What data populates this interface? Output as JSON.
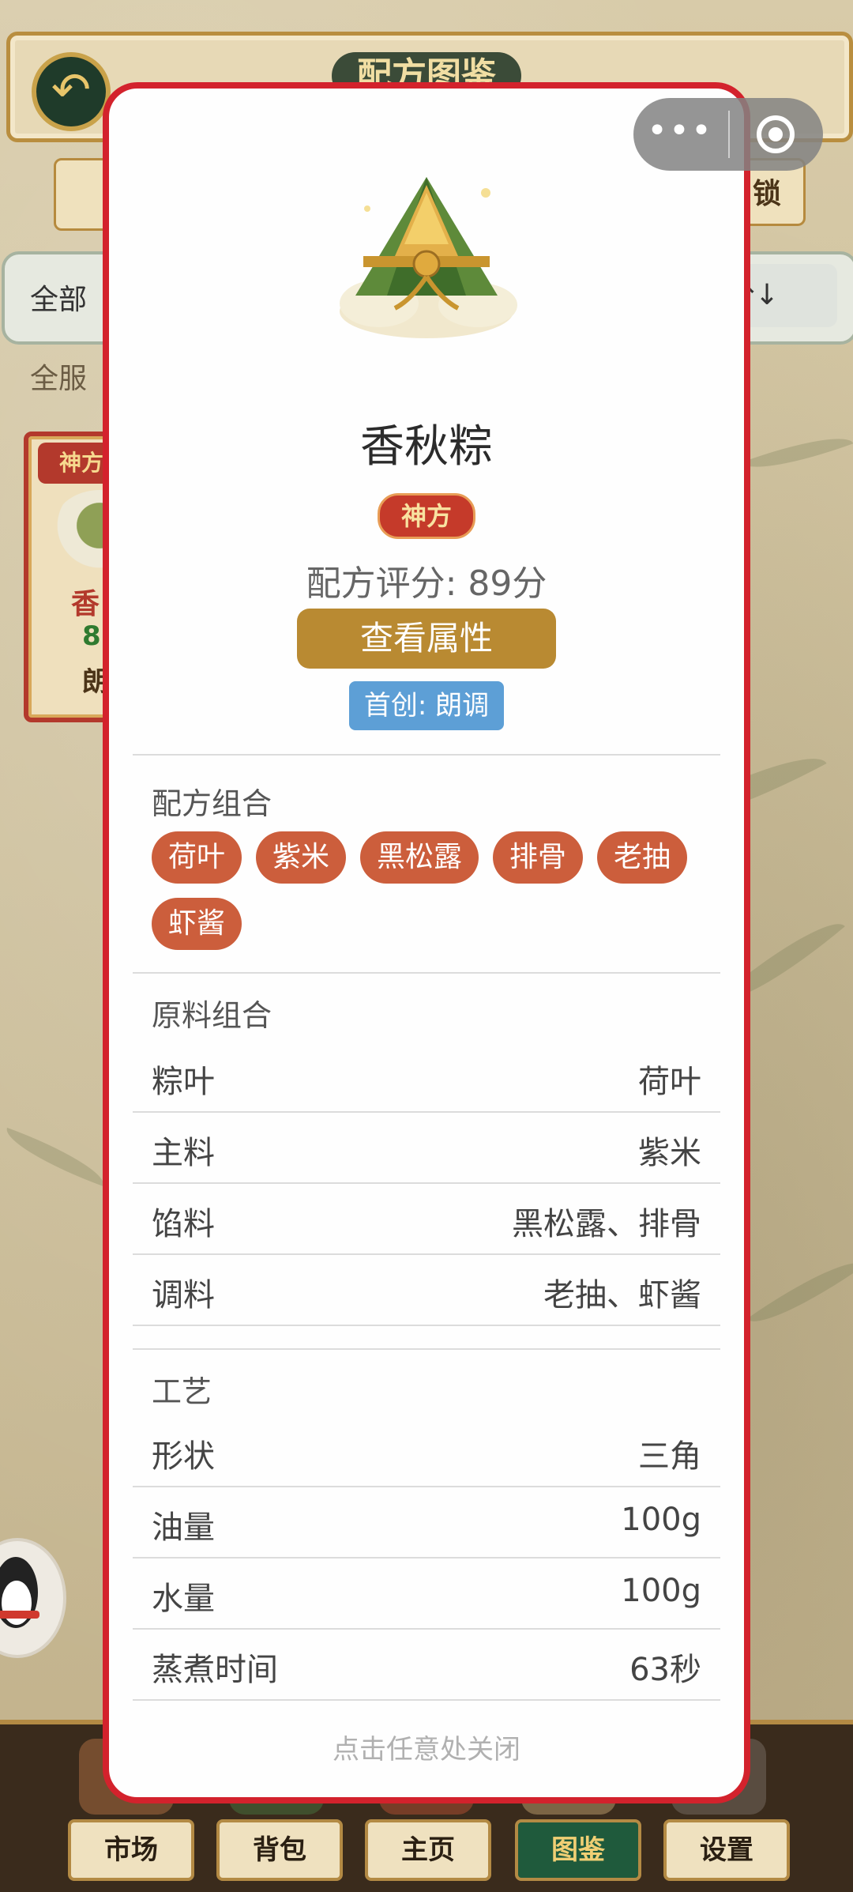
{
  "background": {
    "header_title": "配方图鉴",
    "tab_right_label": "锁",
    "filter_left": "全部",
    "filter_right": "分↓",
    "server_text": "全服",
    "card_tag": "神方",
    "card_line1": "香",
    "card_line2": "8",
    "card_line3": "朗",
    "bottom_nav": [
      "市场",
      "背包",
      "主页",
      "图鉴",
      "设置"
    ],
    "bottom_nav_active": "图鉴"
  },
  "capsule": {
    "more_label": "•••"
  },
  "modal": {
    "title": "香秋粽",
    "badge": "神方",
    "score": "配方评分: 89分",
    "view_button": "查看属性",
    "creator": "首创: 朗调",
    "recipe_section": {
      "title": "配方组合",
      "chips": [
        "荷叶",
        "紫米",
        "黑松露",
        "排骨",
        "老抽",
        "虾酱"
      ]
    },
    "ingredients_section": {
      "title": "原料组合",
      "rows": [
        {
          "label": "粽叶",
          "value": "荷叶"
        },
        {
          "label": "主料",
          "value": "紫米"
        },
        {
          "label": "馅料",
          "value": "黑松露、排骨"
        },
        {
          "label": "调料",
          "value": "老抽、虾酱"
        }
      ]
    },
    "craft_section": {
      "title": "工艺",
      "rows": [
        {
          "label": "形状",
          "value": "三角"
        },
        {
          "label": "油量",
          "value": "100g"
        },
        {
          "label": "水量",
          "value": "100g"
        },
        {
          "label": "蒸煮时间",
          "value": "63秒"
        }
      ]
    },
    "close_hint": "点击任意处关闭"
  },
  "colors": {
    "modal_border": "#d3222c",
    "chip": "#cc5e3c",
    "view_button": "#b98a32",
    "creator_badge": "#5d9fd6",
    "badge_red": "#c53a2a"
  },
  "icons": {
    "back": "arrow-back-icon",
    "capsule_more": "more-dots-icon",
    "capsule_close": "target-close-icon",
    "item_image": "zongzi-icon"
  }
}
